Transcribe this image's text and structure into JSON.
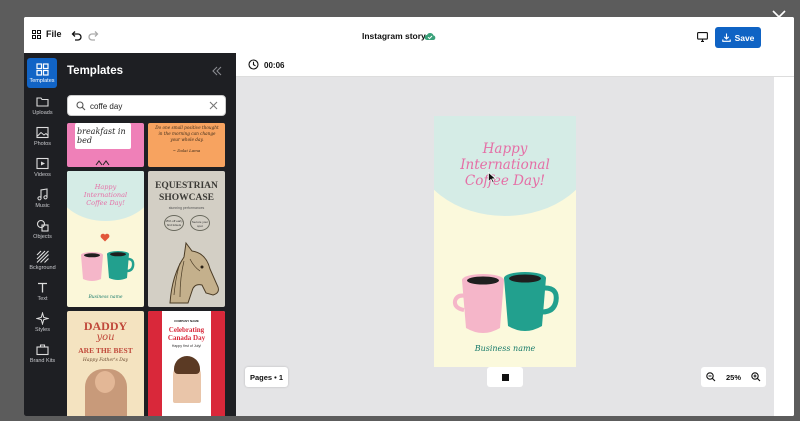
{
  "header": {
    "file_label": "File",
    "doc_title": "Instagram story",
    "save_label": "Save"
  },
  "rail": {
    "items": [
      {
        "label": "Templates",
        "icon": "templates-icon"
      },
      {
        "label": "Uploads",
        "icon": "folder-icon"
      },
      {
        "label": "Photos",
        "icon": "image-icon"
      },
      {
        "label": "Videos",
        "icon": "video-icon"
      },
      {
        "label": "Music",
        "icon": "music-icon"
      },
      {
        "label": "Objects",
        "icon": "shapes-icon"
      },
      {
        "label": "Bckground",
        "icon": "background-icon"
      },
      {
        "label": "Text",
        "icon": "text-icon"
      },
      {
        "label": "Styles",
        "icon": "sparkle-icon"
      },
      {
        "label": "Brand Kits",
        "icon": "briefcase-icon"
      }
    ]
  },
  "panel": {
    "title": "Templates",
    "search_value": "coffe day"
  },
  "thumbs": {
    "pink_text": "breakfast in bed",
    "orange_text": "Do one small positive thought in the morning can change your whole day.",
    "orange_author": "~ Dalai Lama",
    "coffee_title": "Happy International Coffee Day!",
    "coffee_biz": "Business name",
    "horse_title_1": "EQUESTRIAN",
    "horse_title_2": "SHOWCASE",
    "horse_sub": "stunning performances",
    "horse_badge_1": "15% off early bird tickets",
    "horse_badge_2": "Secure your spot",
    "dad_line1": "DADDY",
    "dad_line2": "you",
    "dad_line3": "ARE THE BEST",
    "dad_line4": "Happy Father's Day",
    "canada_company": "COMPANY NAME",
    "canada_title": "Celebrating Canada Day",
    "canada_sub": "Happy first of July!"
  },
  "stage": {
    "timer": "00:06",
    "design_title_1": "Happy",
    "design_title_2": "International",
    "design_title_3": "Coffee Day!",
    "design_biz": "Business name",
    "pages_label": "Pages • 1",
    "zoom_value": "25%"
  },
  "colors": {
    "accent": "#0f63c4",
    "rail_bg": "#1e1f23",
    "design_pink": "#e56fa6",
    "design_teal": "#22a08e"
  }
}
